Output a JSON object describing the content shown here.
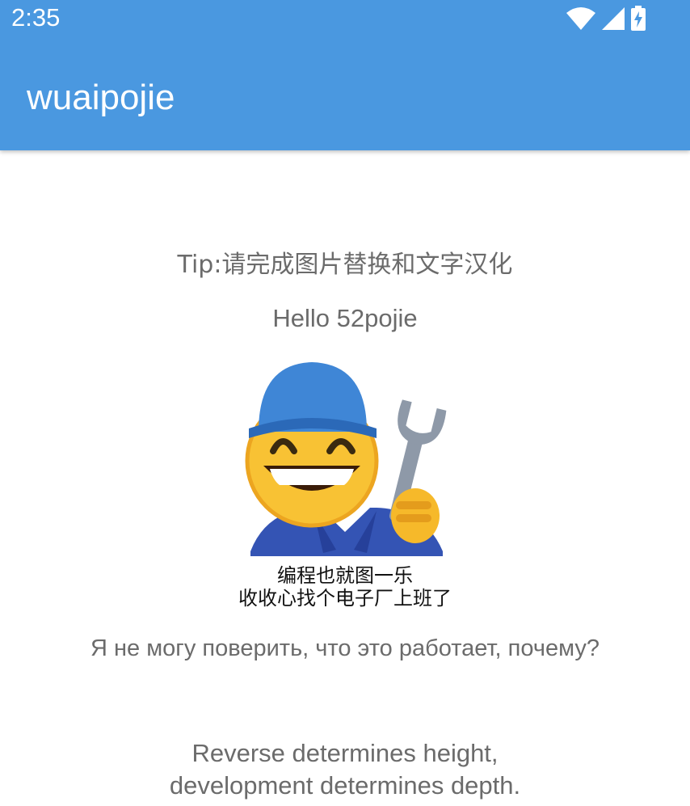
{
  "status_bar": {
    "time": "2:35",
    "icons": [
      "wifi-icon",
      "cell-signal-icon",
      "battery-charging-icon"
    ]
  },
  "app_bar": {
    "title": "wuaipojie",
    "color": "#4a98e0"
  },
  "content": {
    "tip": "Tip:请完成图片替换和文字汉化",
    "hello": "Hello 52pojie",
    "image": {
      "icon": "mechanic-emoji-meme",
      "caption_line1": "编程也就图一乐",
      "caption_line2": "收收心找个电子厂上班了"
    },
    "russian_text": "Я не могу поверить, что это работает, почему?",
    "motto_line1": "Reverse determines height,",
    "motto_line2": "development determines depth."
  }
}
